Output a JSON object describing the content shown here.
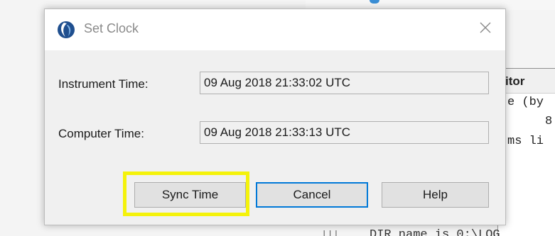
{
  "background_app": {
    "monitor_title": "itor",
    "text_lines": [
      "e (by",
      "8",
      "ms li"
    ],
    "bottom_text": "DIR name is 0:\\LOG",
    "bottom_bars": "|||"
  },
  "dialog": {
    "title": "Set Clock",
    "icon": "app-logo-icon",
    "close_icon": "close-icon",
    "fields": {
      "instrument_label": "Instrument Time:",
      "instrument_value": "09 Aug 2018 21:33:02 UTC",
      "computer_label": "Computer Time:",
      "computer_value": "09 Aug 2018 21:33:13 UTC"
    },
    "buttons": {
      "sync": "Sync Time",
      "cancel": "Cancel",
      "help": "Help"
    }
  },
  "colors": {
    "highlight": "#f4f20a",
    "focus_border": "#0078d7",
    "logo": "#1f4f8f"
  }
}
